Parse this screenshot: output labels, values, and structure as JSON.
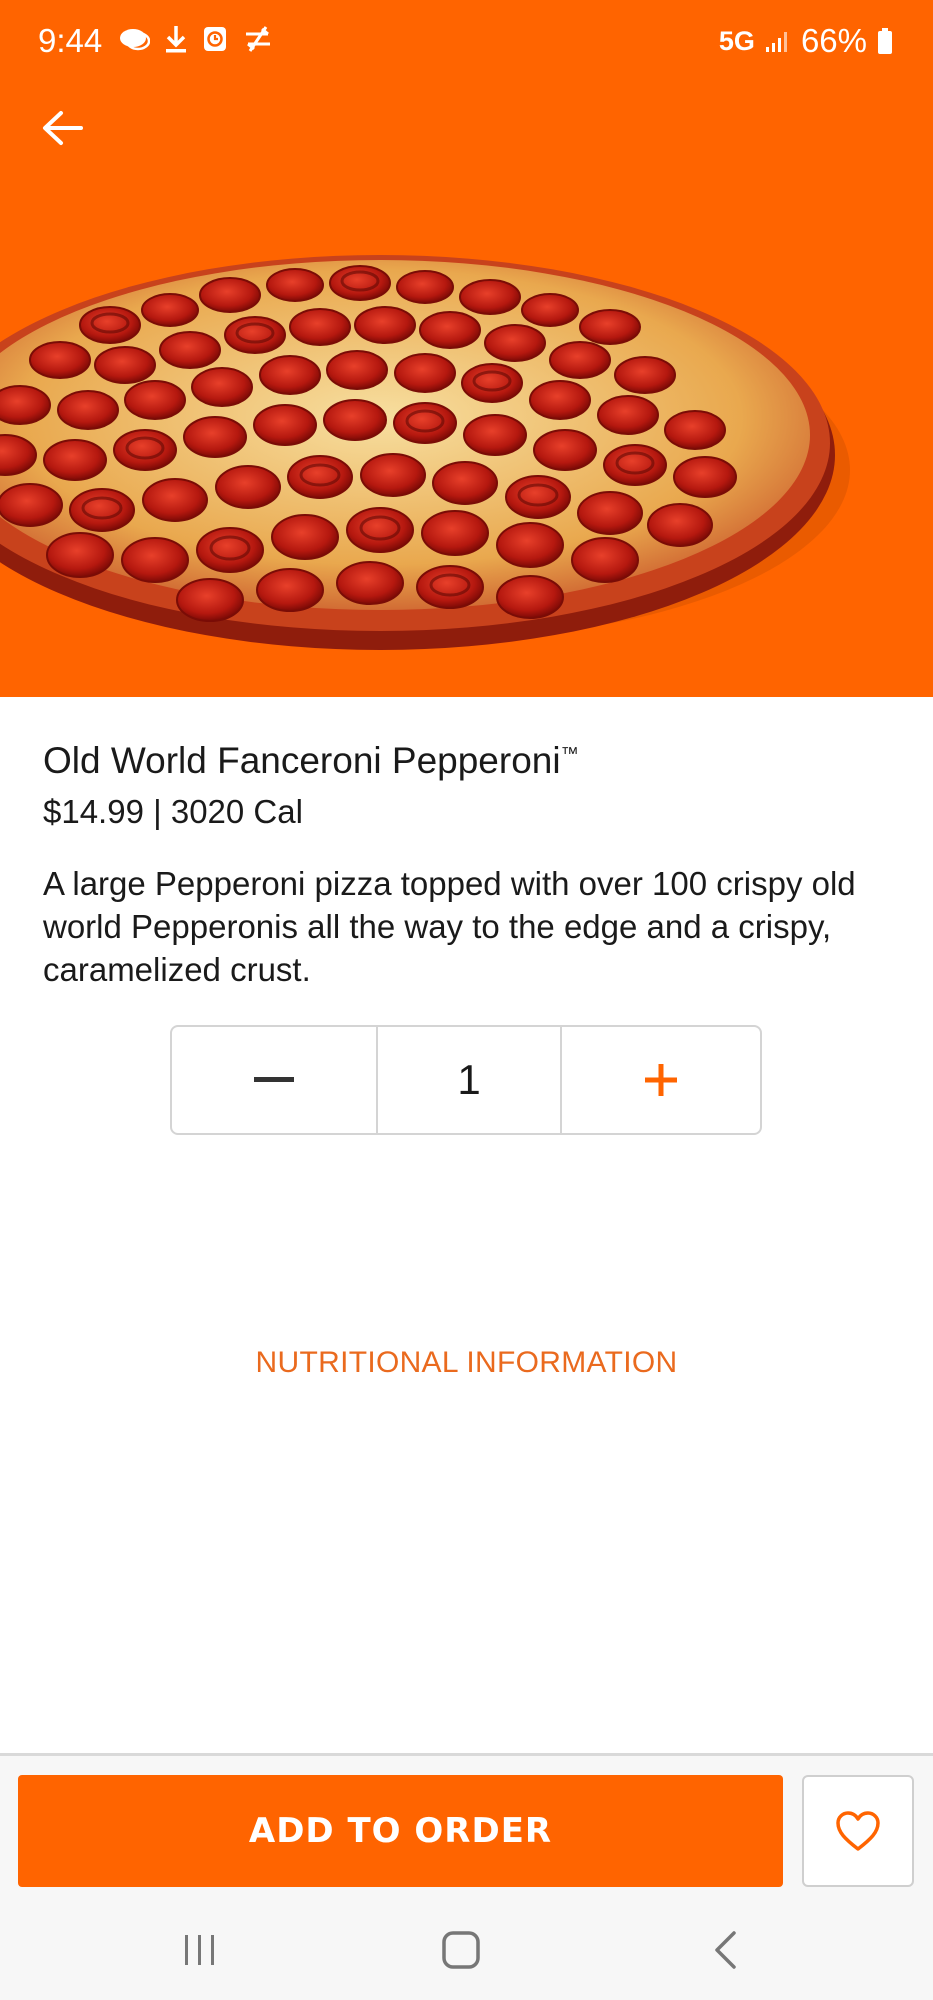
{
  "status_bar": {
    "time": "9:44",
    "network": "5G",
    "battery": "66%"
  },
  "product": {
    "name": "Old World Fanceroni Pepperoni",
    "trademark": "™",
    "price_calories": "$14.99 | 3020 Cal",
    "description": "A large Pepperoni pizza topped with over 100 crispy old world Pepperonis all the way to the edge and a crispy, caramelized crust.",
    "image_icon": "pepperoni-pizza-image"
  },
  "quantity": {
    "value": "1",
    "decrement_icon": "minus-icon",
    "increment_icon": "plus-icon"
  },
  "links": {
    "nutrition": "NUTRITIONAL INFORMATION"
  },
  "actions": {
    "add_to_order": "ADD TO ORDER",
    "favorite_icon": "heart-icon"
  },
  "colors": {
    "brand_orange": "#ff6400",
    "link_orange": "#ea6a1e"
  }
}
